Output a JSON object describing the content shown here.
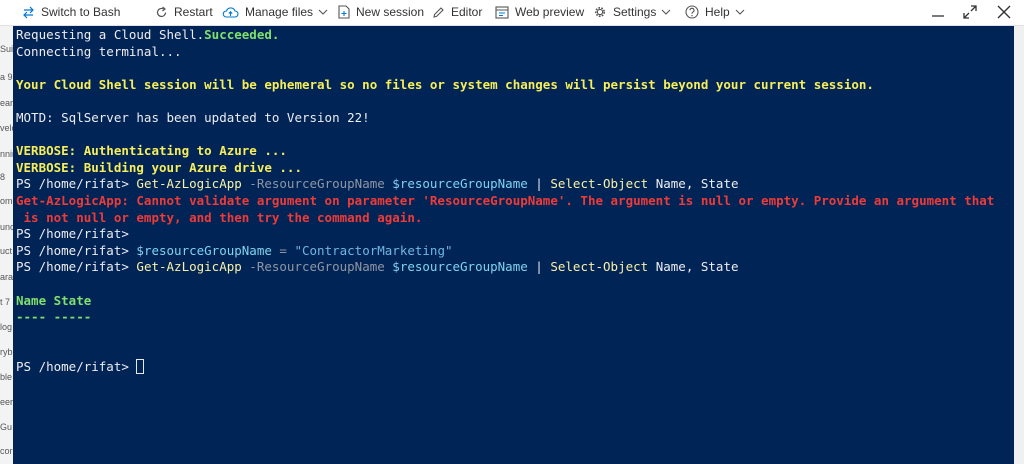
{
  "toolbar": {
    "switch_label": "Switch to Bash",
    "restart_label": "Restart",
    "manage_files_label": "Manage files",
    "new_session_label": "New session",
    "editor_label": "Editor",
    "web_preview_label": "Web preview",
    "settings_label": "Settings",
    "help_label": "Help"
  },
  "left_strip": [
    "Suic",
    "a 9",
    "ear",
    "velo",
    "nnin",
    "8",
    "ome",
    "unc",
    "uct",
    "ara",
    "t 7",
    "log",
    "ryb",
    "ble",
    "eer",
    "Gu",
    "cor"
  ],
  "terminal": {
    "l1_a": "Requesting a Cloud Shell.",
    "l1_b": "Succeeded.",
    "l2": "Connecting terminal...",
    "l4": "Your Cloud Shell session will be ephemeral so no files or system changes will persist beyond your current session.",
    "l6": "MOTD: SqlServer has been updated to Version 22!",
    "l8": "VERBOSE: Authenticating to Azure ...",
    "l9": "VERBOSE: Building your Azure drive ...",
    "prompt": "PS /home/rifat> ",
    "cmd": "Get-AzLogicApp",
    "param": " -ResourceGroupName ",
    "var": "$resourceGroupName",
    "pipe": " | ",
    "cmd2": "Select-Object",
    "args": " Name, State",
    "err1": "Get-AzLogicApp: Cannot validate argument on parameter 'ResourceGroupName'. The argument is null or empty. Provide an argument that",
    "err2": " is not null or empty, and then try the command again.",
    "prompt_bare": "PS /home/rifat>",
    "assign_op": " = ",
    "assign_val": "\"ContractorMarketing\"",
    "hdr": "Name State",
    "sep": "---- -----"
  },
  "colors": {
    "terminal_bg": "#012456",
    "yellow": "#f7ee59",
    "green": "#7ee16c",
    "red": "#ee3b38"
  }
}
